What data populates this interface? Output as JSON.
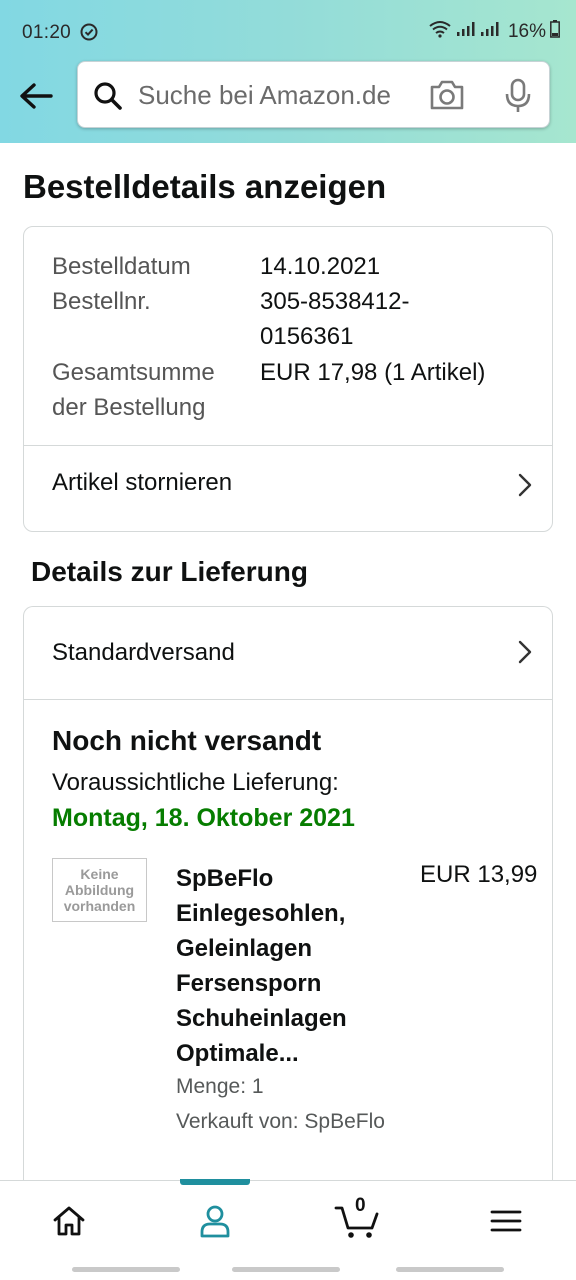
{
  "status_bar": {
    "time": "01:20",
    "battery": "16%"
  },
  "header": {
    "search_placeholder": "Suche bei Amazon.de"
  },
  "page": {
    "title": "Bestelldetails anzeigen"
  },
  "order_summary": {
    "date_label": "Bestelldatum",
    "date_value": "14.10.2021",
    "number_label": "Bestellnr.",
    "number_value_line1": "305-8538412-",
    "number_value_line2": "0156361",
    "total_label_line1": "Gesamtsumme",
    "total_label_line2": "der Bestellung",
    "total_value": "EUR 17,98 (1 Artikel)",
    "cancel_link": "Artikel stornieren"
  },
  "delivery": {
    "section_title": "Details zur Lieferung",
    "shipping_method": "Standardversand",
    "status": "Noch nicht versandt",
    "expected_label": "Voraussichtliche Lieferung:",
    "expected_date": "Montag, 18. Oktober 2021"
  },
  "item": {
    "thumb_line1": "Keine",
    "thumb_line2": "Abbildung",
    "thumb_line3": "vorhanden",
    "title_line1": "SpBeFlo",
    "title_line2": "Einlegesohlen,",
    "title_line3": "Geleinlagen",
    "title_line4": "Fersensporn",
    "title_line5": "Schuheinlagen",
    "title_line6": "Optimale...",
    "price": "EUR 13,99",
    "quantity": "Menge: 1",
    "seller": "Verkauft von: SpBeFlo"
  },
  "bottom_nav": {
    "cart_count": "0",
    "active_tab": "account",
    "accent_color": "#1f8f9e"
  },
  "colors": {
    "delivery_green": "#067d00",
    "header_gradient_start": "#82d8e3",
    "header_gradient_end": "#a6e6cf"
  }
}
